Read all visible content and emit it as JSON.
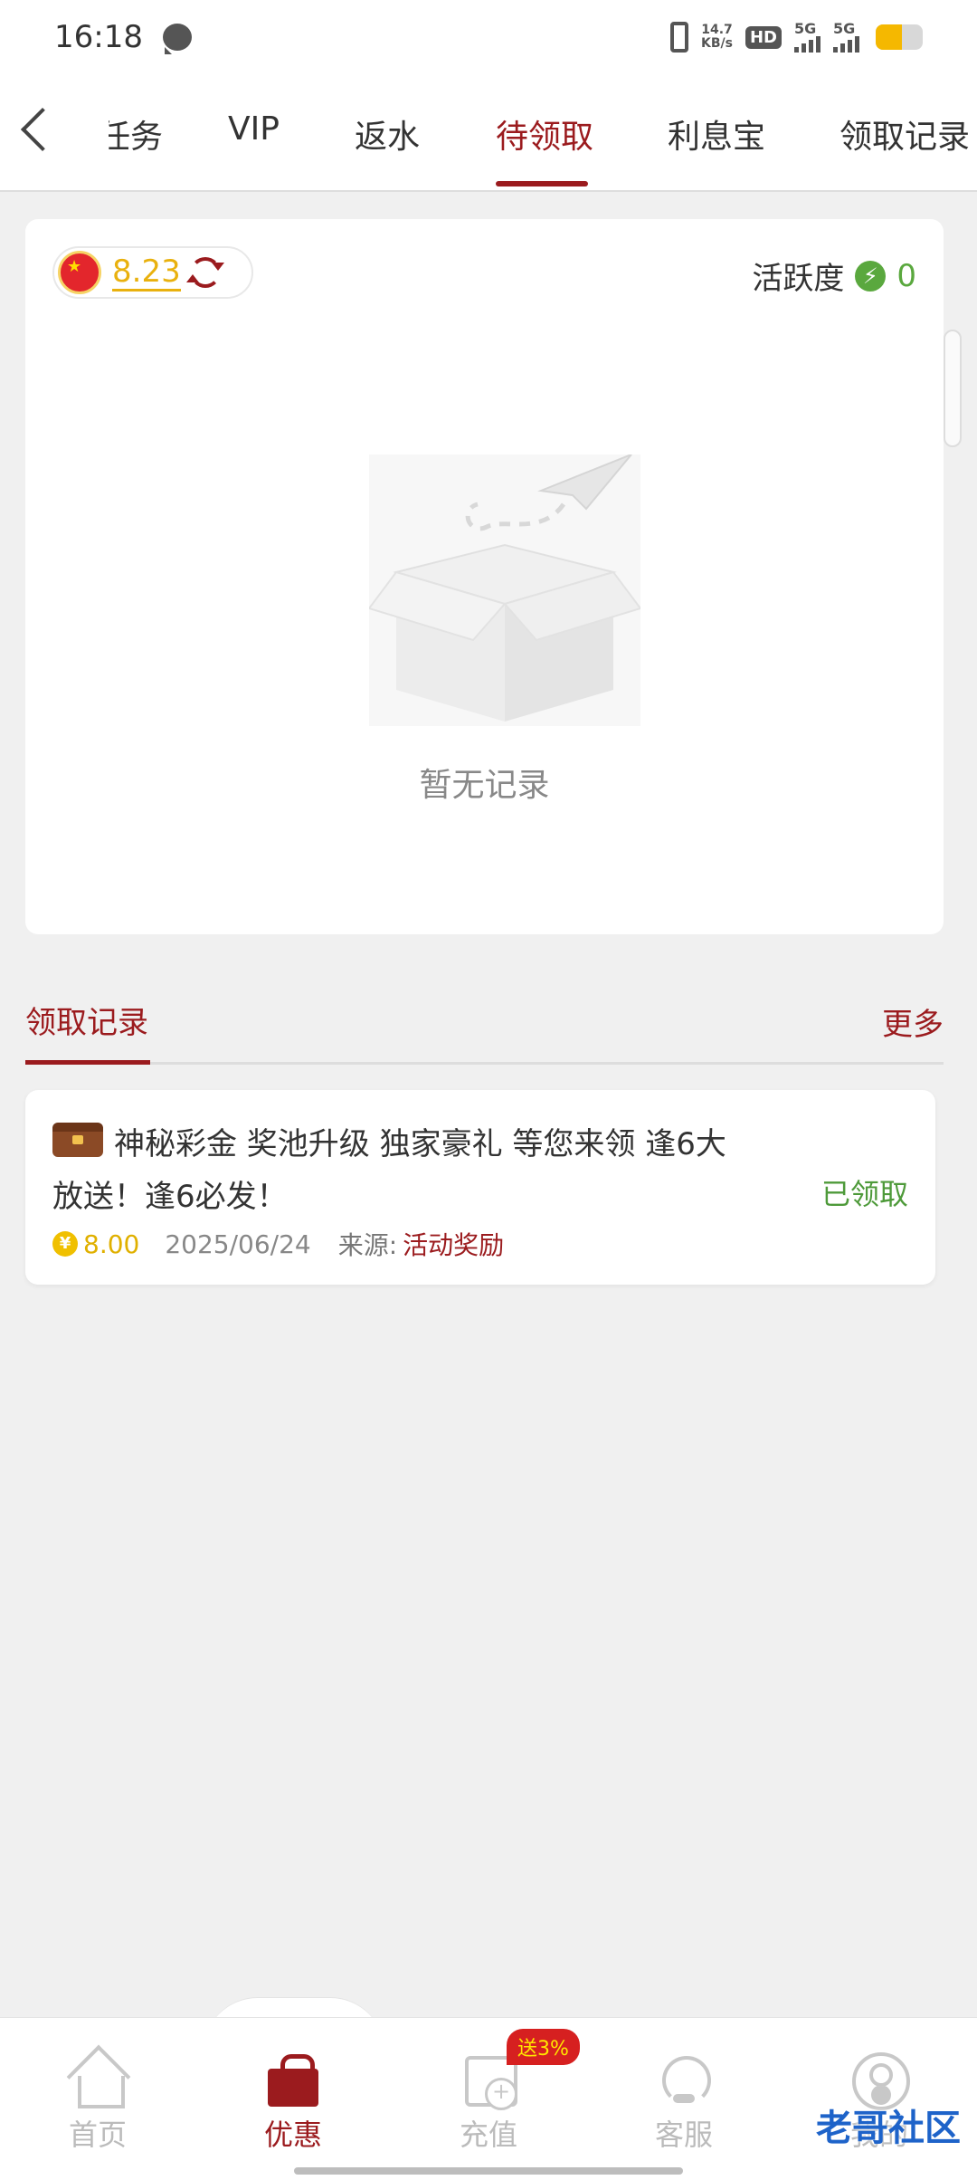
{
  "status_bar": {
    "time": "16:18",
    "net_speed_value": "14.7",
    "net_speed_unit": "KB/s",
    "hd_label": "HD",
    "sim1_label": "5G",
    "sim2_label": "5G",
    "battery_level": 0.55
  },
  "topnav": {
    "tabs": [
      {
        "label": "任务"
      },
      {
        "label": "VIP"
      },
      {
        "label": "返水"
      },
      {
        "label": "待领取"
      },
      {
        "label": "利息宝"
      },
      {
        "label": "领取记录"
      }
    ],
    "active_index": 3
  },
  "card": {
    "balance": "8.23",
    "activity_label": "活跃度",
    "activity_value": "0",
    "empty_text": "暂无记录"
  },
  "records": {
    "title": "领取记录",
    "more_label": "更多",
    "items": [
      {
        "title_line1": "神秘彩金 奖池升级 独家豪礼 等您来领 逢6大",
        "title_line2": "放送！逢6必发！",
        "status": "已领取",
        "amount": "8.00",
        "date": "2025/06/24",
        "source_label": "来源:",
        "source": "活动奖励"
      }
    ]
  },
  "bottom_nav": {
    "items": [
      {
        "label": "首页",
        "icon": "home-icon"
      },
      {
        "label": "优惠",
        "icon": "gift-icon"
      },
      {
        "label": "充值",
        "icon": "recharge-icon"
      },
      {
        "label": "客服",
        "icon": "headset-icon"
      },
      {
        "label": "我的",
        "icon": "user-icon"
      }
    ],
    "recharge_badge": "送3%",
    "active_index": 1
  },
  "watermark": "老哥社区",
  "colors": {
    "accent": "#9b1b1e",
    "gold": "#e9b10e",
    "green": "#5aa83e",
    "background": "#f0f0f0"
  }
}
